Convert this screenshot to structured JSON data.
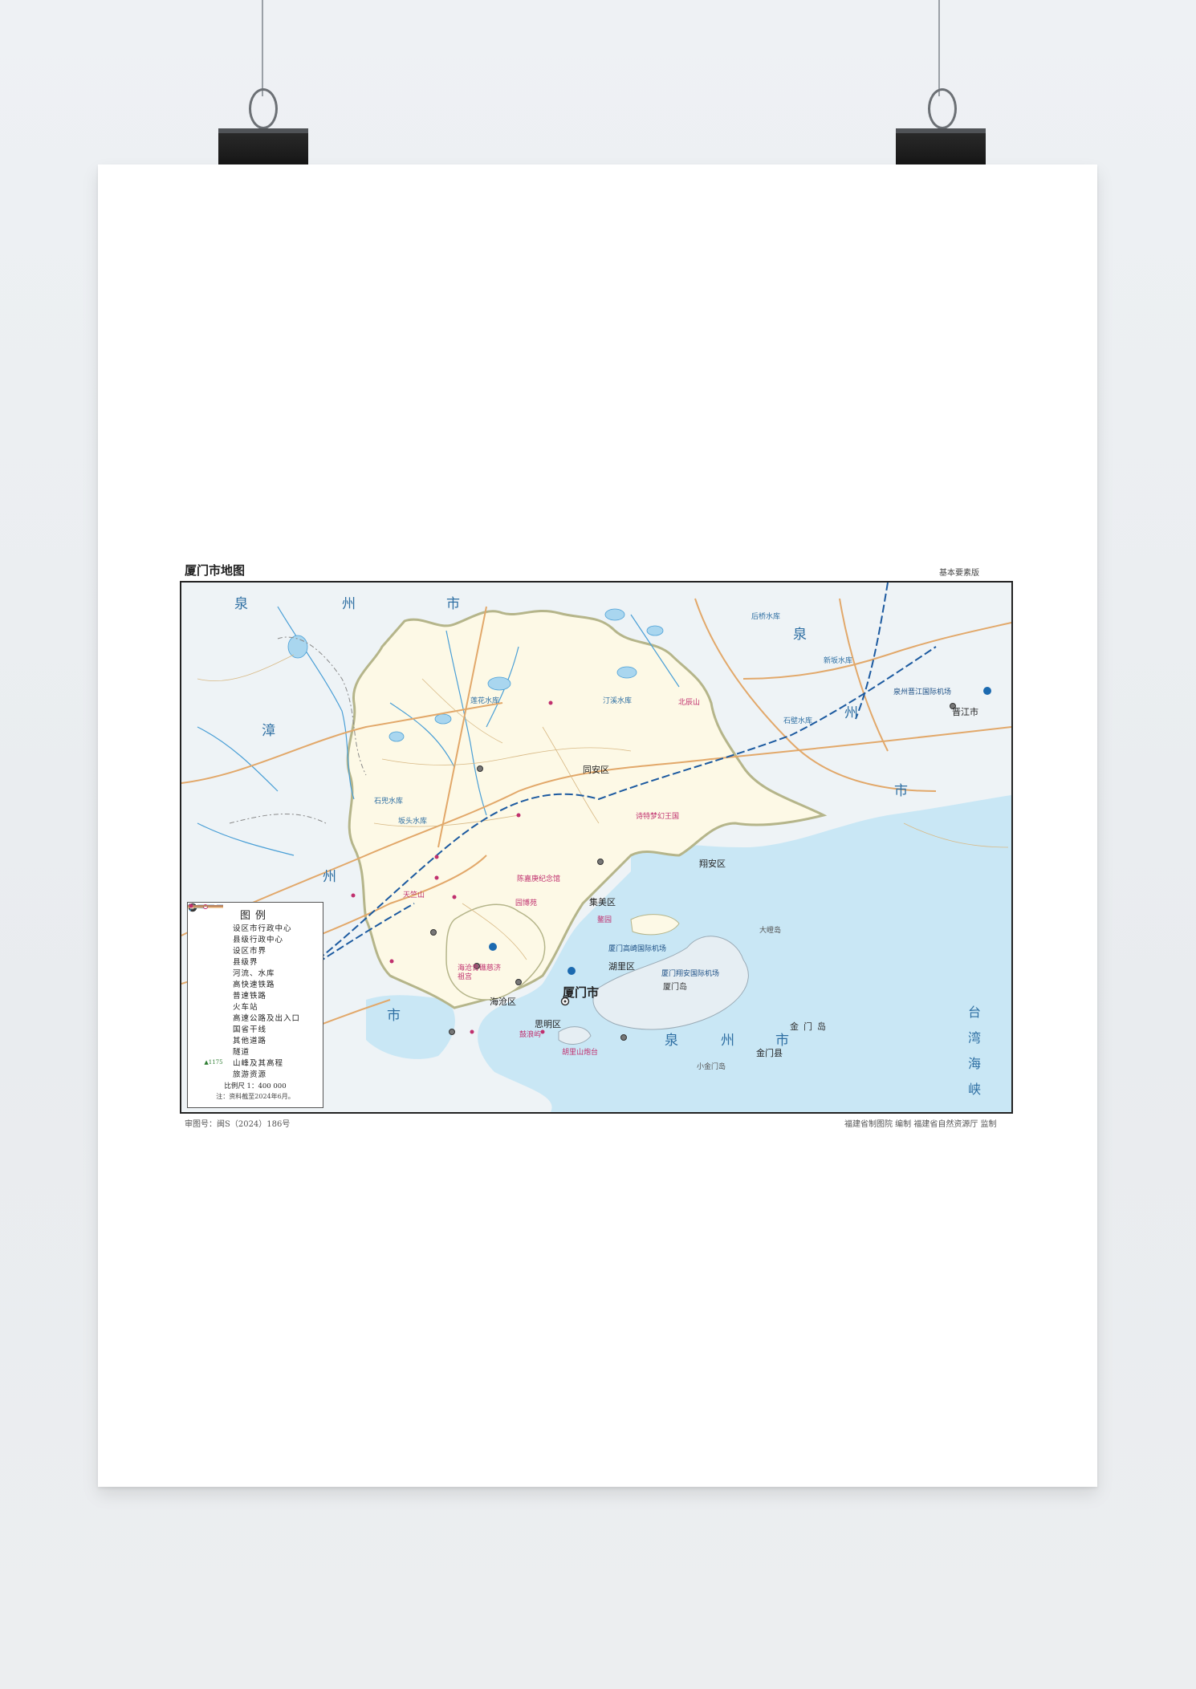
{
  "map": {
    "title": "厦门市地图",
    "edition": "基本要素版",
    "approval_number": "审图号：闽S（2024）186号",
    "credits": "福建省制图院  编制    福建省自然资源厅  监制",
    "colors": {
      "land_xiamen": "#fdf9e6",
      "land_other": "#eef3f6",
      "sea": "#c9e7f5",
      "boundary": "#b5b58a",
      "highway": "#e2a86a",
      "railway": "#1c5aa0",
      "river": "#4a9fd6",
      "poi": "#c0306e"
    },
    "regions": [
      {
        "name": "泉",
        "kind": "region"
      },
      {
        "name": "州",
        "kind": "region"
      },
      {
        "name": "市",
        "kind": "region"
      },
      {
        "name": "漳",
        "kind": "region"
      },
      {
        "name": "州",
        "kind": "region"
      },
      {
        "name": "市",
        "kind": "region"
      },
      {
        "name": "泉",
        "kind": "region"
      },
      {
        "name": "州",
        "kind": "region"
      },
      {
        "name": "市",
        "kind": "region"
      },
      {
        "name": "泉",
        "kind": "region"
      },
      {
        "name": "州",
        "kind": "region"
      },
      {
        "name": "市",
        "kind": "region"
      }
    ],
    "cities": [
      {
        "name": "厦门市",
        "kind": "prefecture"
      },
      {
        "name": "同安区",
        "kind": "district"
      },
      {
        "name": "翔安区",
        "kind": "district"
      },
      {
        "name": "集美区",
        "kind": "district"
      },
      {
        "name": "湖里区",
        "kind": "district"
      },
      {
        "name": "海沧区",
        "kind": "district"
      },
      {
        "name": "思明区",
        "kind": "district"
      },
      {
        "name": "晋江市",
        "kind": "county"
      },
      {
        "name": "金门县",
        "kind": "county"
      }
    ],
    "islands": [
      "厦门岛",
      "金门岛",
      "大嶝岛",
      "小金门岛"
    ],
    "water": [
      "台湾海峡",
      "汀溪水库",
      "石兜水库",
      "坂头水库",
      "莲花水库",
      "石壁水库",
      "后桥水库",
      "新坂水库"
    ],
    "airports": [
      "泉州晋江国际机场",
      "厦门高崎国际机场",
      "厦门翔安国际机场"
    ],
    "pois": [
      "北辰山",
      "诗特梦幻王国",
      "鳌园",
      "园博苑",
      "海沧青礁慈济祖宫",
      "鼓浪屿",
      "胡里山炮台",
      "天竺山",
      "陈嘉庚纪念馆"
    ],
    "legend": {
      "title": "图例",
      "items": [
        {
          "symbol": "prefecture",
          "label": "设区市行政中心"
        },
        {
          "symbol": "county",
          "label": "县级行政中心"
        },
        {
          "symbol": "city-boundary",
          "label": "设区市界"
        },
        {
          "symbol": "county-boundary",
          "label": "县级界"
        },
        {
          "symbol": "river",
          "label": "河流、水库"
        },
        {
          "symbol": "hsr",
          "label": "高快速铁路"
        },
        {
          "symbol": "rail",
          "label": "普速铁路"
        },
        {
          "symbol": "station",
          "label": "火车站"
        },
        {
          "symbol": "expressway",
          "label": "高速公路及出入口"
        },
        {
          "symbol": "national-road",
          "label": "国省干线"
        },
        {
          "symbol": "other-road",
          "label": "其他道路"
        },
        {
          "symbol": "tunnel",
          "label": "隧道"
        },
        {
          "symbol": "peak",
          "label": "山峰及其高程"
        },
        {
          "symbol": "poi",
          "label": "旅游资源"
        }
      ],
      "peak_sample": "▲1175",
      "scale": "比例尺  1：400 000",
      "note": "注：资料截至2024年6月。"
    }
  }
}
